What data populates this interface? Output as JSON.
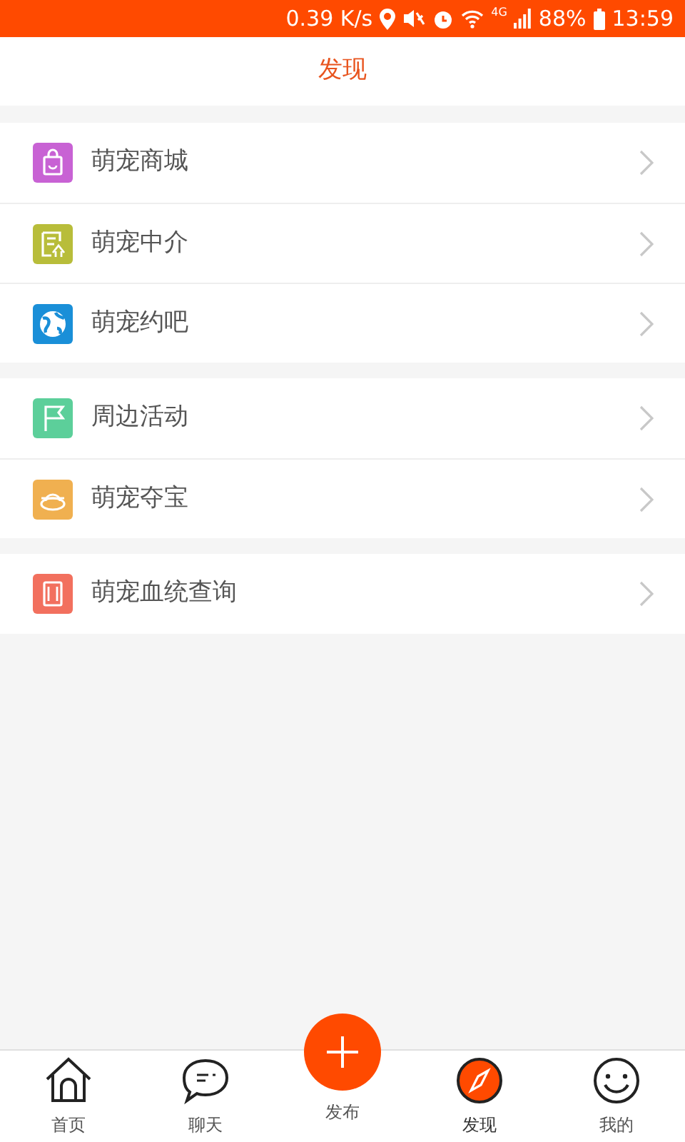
{
  "status_bar": {
    "speed": "0.39 K/s",
    "network": "4G",
    "battery": "88%",
    "time": "13:59"
  },
  "header": {
    "title": "发现"
  },
  "groups": [
    {
      "items": [
        {
          "label": "萌宠商城",
          "kind": "bag",
          "color": "#c862d4"
        },
        {
          "label": "萌宠中介",
          "kind": "doc",
          "color": "#b8bd3a"
        },
        {
          "label": "萌宠约吧",
          "kind": "globe",
          "color": "#1a8fd8"
        }
      ]
    },
    {
      "items": [
        {
          "label": "周边活动",
          "kind": "flag",
          "color": "#5ccf9a"
        },
        {
          "label": "萌宠夺宝",
          "kind": "ingot",
          "color": "#f0b050"
        }
      ]
    },
    {
      "items": [
        {
          "label": "萌宠血统查询",
          "kind": "book",
          "color": "#f2705e"
        }
      ]
    }
  ],
  "tab_bar": [
    {
      "label": "首页",
      "kind": "home",
      "selected": false
    },
    {
      "label": "聊天",
      "kind": "chat",
      "selected": false
    },
    {
      "label": "发布",
      "kind": "publish",
      "selected": false
    },
    {
      "label": "发现",
      "kind": "compass",
      "selected": true
    },
    {
      "label": "我的",
      "kind": "smile",
      "selected": false
    }
  ]
}
